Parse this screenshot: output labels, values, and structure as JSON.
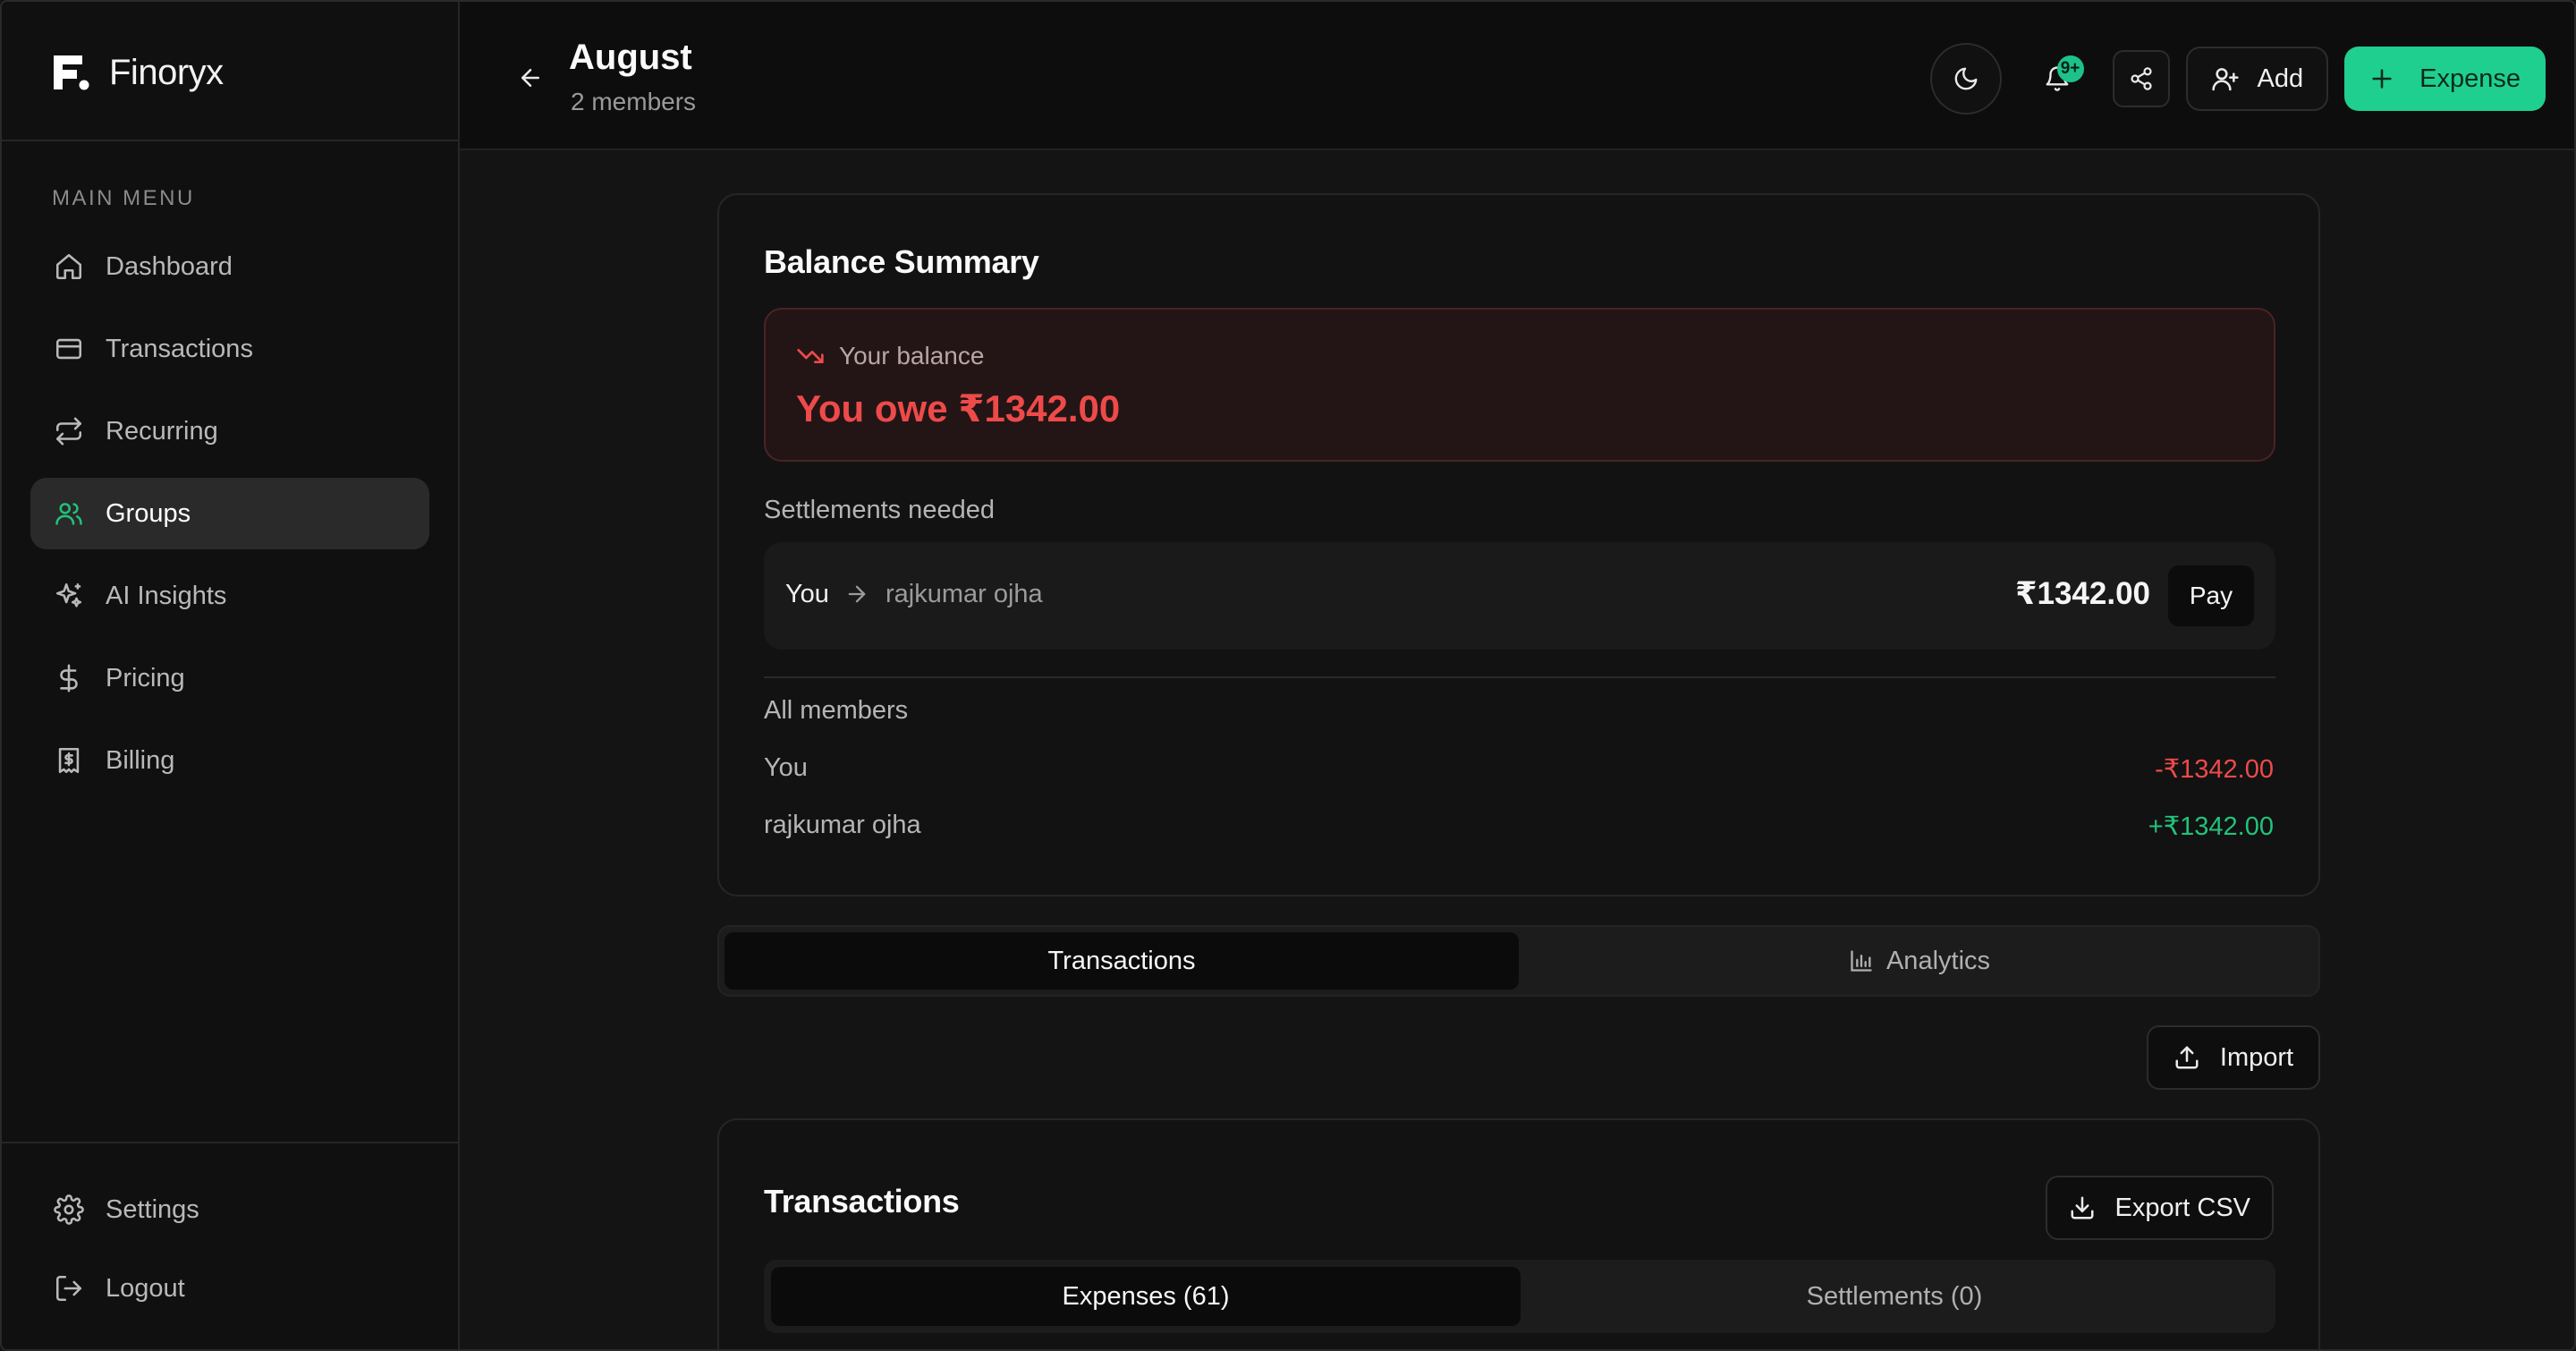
{
  "sidebar": {
    "brand": "Finoryx",
    "menu_title": "MAIN MENU",
    "items": [
      {
        "label": "Dashboard",
        "icon": "home-icon"
      },
      {
        "label": "Transactions",
        "icon": "card-icon"
      },
      {
        "label": "Recurring",
        "icon": "repeat-icon"
      },
      {
        "label": "Groups",
        "icon": "users-icon",
        "active": true
      },
      {
        "label": "AI Insights",
        "icon": "sparkles-icon"
      },
      {
        "label": "Pricing",
        "icon": "dollar-icon"
      },
      {
        "label": "Billing",
        "icon": "receipt-icon"
      }
    ],
    "bottom_items": [
      {
        "label": "Settings",
        "icon": "gear-icon"
      },
      {
        "label": "Logout",
        "icon": "logout-icon"
      }
    ]
  },
  "header": {
    "title": "August",
    "subtitle": "2 members",
    "notification_badge": "9+",
    "add_label": "Add",
    "expense_label": "Expense"
  },
  "balance_summary": {
    "title": "Balance Summary",
    "your_balance_label": "Your balance",
    "your_balance_value": "You owe ₹1342.00",
    "settlements_label": "Settlements needed",
    "settlement": {
      "from": "You",
      "to": "rajkumar ojha",
      "amount": "₹1342.00",
      "action": "Pay"
    },
    "all_members_label": "All members",
    "members": [
      {
        "name": "You",
        "amount": "-₹1342.00"
      },
      {
        "name": "rajkumar ojha",
        "amount": "+₹1342.00"
      }
    ]
  },
  "tabs": {
    "transactions": "Transactions",
    "analytics": "Analytics"
  },
  "import_label": "Import",
  "transactions_card": {
    "title": "Transactions",
    "export_label": "Export CSV",
    "subtabs": {
      "expenses": "Expenses (61)",
      "settlements": "Settlements (0)"
    }
  },
  "colors": {
    "accent": "#1fcf90",
    "negative": "#ee4a4a",
    "positive": "#22c27a",
    "background": "#141414"
  }
}
